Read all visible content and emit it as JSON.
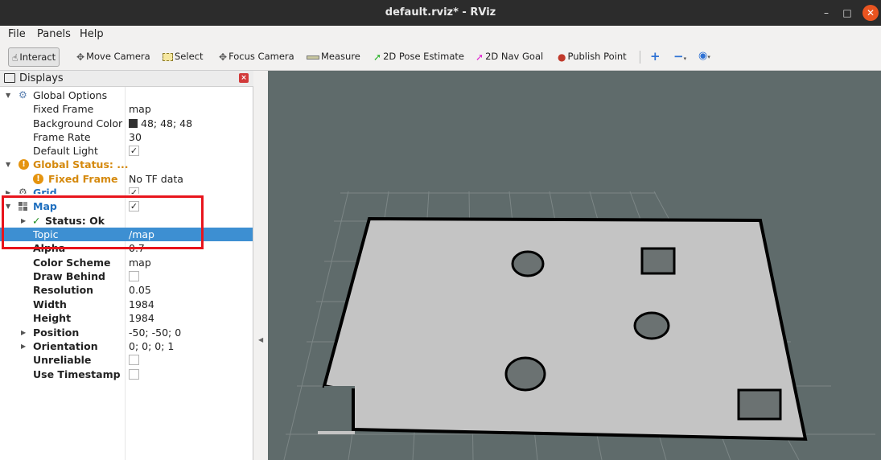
{
  "window": {
    "title": "default.rviz* - RViz"
  },
  "menubar": {
    "items": [
      "File",
      "Panels",
      "Help"
    ]
  },
  "toolbar": {
    "interact": "Interact",
    "move_camera": "Move Camera",
    "select": "Select",
    "focus_camera": "Focus Camera",
    "measure": "Measure",
    "pose_estimate": "2D Pose Estimate",
    "nav_goal": "2D Nav Goal",
    "publish_point": "Publish Point"
  },
  "displays": {
    "title": "Displays",
    "global_options": {
      "label": "Global Options",
      "fixed_frame_key": "Fixed Frame",
      "fixed_frame_val": "map",
      "bg_color_key": "Background Color",
      "bg_color_val": "48; 48; 48",
      "frame_rate_key": "Frame Rate",
      "frame_rate_val": "30",
      "default_light_key": "Default Light",
      "default_light_checked": true
    },
    "global_status": {
      "label": "Global Status: ...",
      "fixed_frame_key": "Fixed Frame",
      "fixed_frame_val": "No TF data"
    },
    "grid": {
      "label": "Grid",
      "checked": true
    },
    "map": {
      "label": "Map",
      "checked": true,
      "status": "Status: Ok",
      "topic_key": "Topic",
      "topic_val": "/map",
      "alpha_key": "Alpha",
      "alpha_val": "0.7",
      "color_scheme_key": "Color Scheme",
      "color_scheme_val": "map",
      "draw_behind_key": "Draw Behind",
      "draw_behind_checked": false,
      "resolution_key": "Resolution",
      "resolution_val": "0.05",
      "width_key": "Width",
      "width_val": "1984",
      "height_key": "Height",
      "height_val": "1984",
      "position_key": "Position",
      "position_val": "-50; -50; 0",
      "orientation_key": "Orientation",
      "orientation_val": "0; 0; 0; 1",
      "unreliable_key": "Unreliable",
      "unreliable_checked": false,
      "use_timestamp_key": "Use Timestamp",
      "use_timestamp_checked": false
    }
  },
  "colors": {
    "viewport_bg": "#5f6b6b",
    "selection": "#3d8fd2",
    "highlight_box": "#e8141c",
    "map_free": "#c4c4c4",
    "map_occupied": "#000000"
  }
}
